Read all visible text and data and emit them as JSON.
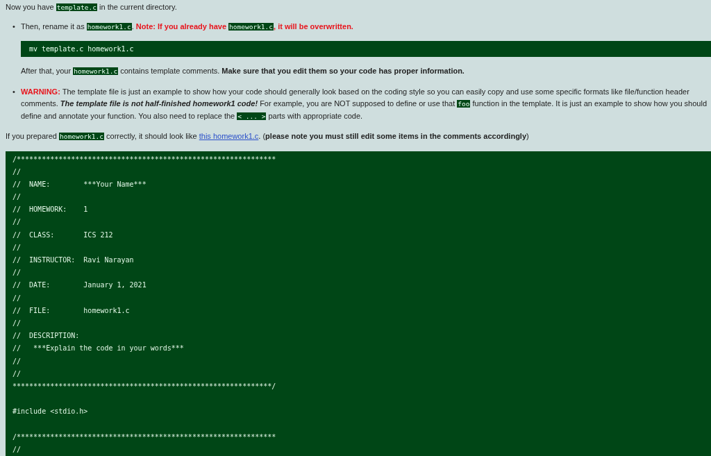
{
  "intro": [
    {
      "kind": "text",
      "text": "Now you have "
    },
    {
      "kind": "code",
      "text": "template.c"
    },
    {
      "kind": "text",
      "text": " in the current directory."
    }
  ],
  "steps": [
    {
      "marker": "•",
      "paragraphs": [
        [
          {
            "kind": "text",
            "text": "Then, rename it as "
          },
          {
            "kind": "code",
            "text": "homework1.c"
          },
          {
            "kind": "text",
            "text": ". "
          },
          {
            "kind": "alert",
            "text": "Note: If you already have "
          },
          {
            "kind": "code",
            "text": "homework1.c"
          },
          {
            "kind": "alert",
            "text": ", it will be overwritten."
          }
        ]
      ],
      "command": "mv template.c homework1.c",
      "after": [
        {
          "kind": "text",
          "text": "After that, your "
        },
        {
          "kind": "code",
          "text": "homework1.c"
        },
        {
          "kind": "text",
          "text": " contains template comments. "
        },
        {
          "kind": "strong",
          "text": "Make sure that you edit them so your code has proper information."
        }
      ]
    },
    {
      "marker": "•",
      "paragraphs": [
        [
          {
            "kind": "alert",
            "text": "WARNING:"
          },
          {
            "kind": "text",
            "text": " The template file is just an example to show how your code should generally look based on the coding style so you can easily copy and use some specific formats like file/function header comments. "
          },
          {
            "kind": "emphasis",
            "text": "The template file is not half-finished homework1 code!"
          },
          {
            "kind": "text",
            "text": " For example, you are NOT supposed to define or use that "
          },
          {
            "kind": "code",
            "text": "foo"
          },
          {
            "kind": "text",
            "text": " function in the template. It is just an example to show how you should define and annotate your function. You also need to replace the "
          },
          {
            "kind": "code",
            "text": "< ... >"
          },
          {
            "kind": "text",
            "text": " parts with appropriate code."
          }
        ]
      ]
    }
  ],
  "outro": [
    {
      "kind": "text",
      "text": "If you prepared "
    },
    {
      "kind": "code",
      "text": "homework1.c"
    },
    {
      "kind": "text",
      "text": " correctly, it should look like "
    },
    {
      "kind": "link",
      "text": "this homework1.c"
    },
    {
      "kind": "text",
      "text": ". ("
    },
    {
      "kind": "strong",
      "text": "please note you must still edit some items in the comments accordingly"
    },
    {
      "kind": "text",
      "text": ")"
    }
  ],
  "code_sections": [
    [
      "/**************************************************************",
      "//",
      "//  NAME:        ***Your Name***",
      "//",
      "//  HOMEWORK:    1",
      "//",
      "//  CLASS:       ICS 212",
      "//",
      "//  INSTRUCTOR:  Ravi Narayan",
      "//",
      "//  DATE:        January 1, 2021",
      "//",
      "//  FILE:        homework1.c",
      "//",
      "//  DESCRIPTION:",
      "//   ***Explain the code in your words***",
      "//",
      "//",
      "**************************************************************/"
    ],
    [
      "#include <stdio.h>"
    ],
    [
      "/**************************************************************",
      "//"
    ]
  ]
}
